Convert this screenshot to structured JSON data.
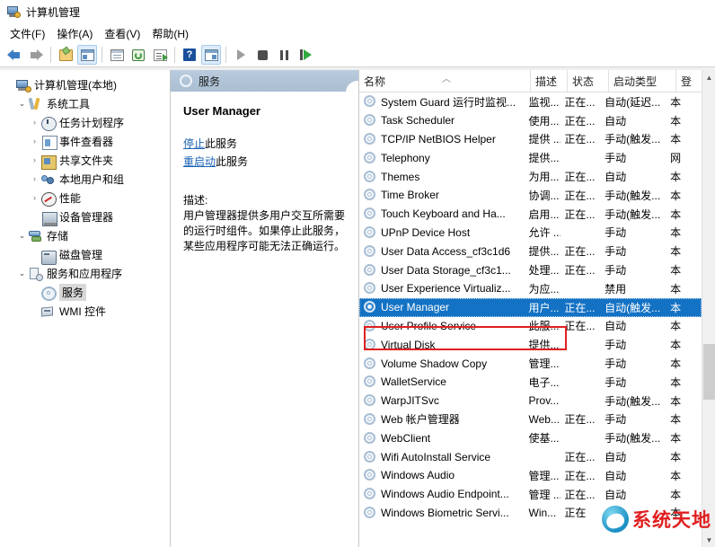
{
  "window": {
    "title": "计算机管理",
    "icon": "computer-management-icon"
  },
  "menu": [
    {
      "label": "文件(F)"
    },
    {
      "label": "操作(A)"
    },
    {
      "label": "查看(V)"
    },
    {
      "label": "帮助(H)"
    }
  ],
  "toolbar": [
    {
      "name": "back-arrow-icon",
      "kind": "back"
    },
    {
      "name": "forward-arrow-icon",
      "kind": "forward"
    },
    {
      "name": "up-folder-icon",
      "kind": "folder"
    },
    {
      "name": "show-console-tree-icon",
      "kind": "pane-left",
      "active": true
    },
    {
      "name": "properties-icon",
      "kind": "props"
    },
    {
      "name": "refresh-icon",
      "kind": "refresh"
    },
    {
      "name": "export-list-icon",
      "kind": "export"
    },
    {
      "name": "help-icon",
      "kind": "help"
    },
    {
      "name": "show-action-pane-icon",
      "kind": "pane-right",
      "active": true
    },
    {
      "name": "start-service-icon",
      "kind": "play"
    },
    {
      "name": "stop-service-icon",
      "kind": "stop"
    },
    {
      "name": "pause-service-icon",
      "kind": "pause"
    },
    {
      "name": "restart-service-icon",
      "kind": "restart"
    }
  ],
  "tree": [
    {
      "label": "计算机管理(本地)",
      "indent": 0,
      "chevron": "",
      "icon": "computer",
      "selected": false
    },
    {
      "label": "系统工具",
      "indent": 1,
      "chevron": "open",
      "icon": "tools",
      "selected": false
    },
    {
      "label": "任务计划程序",
      "indent": 2,
      "chevron": "closed",
      "icon": "clock",
      "selected": false
    },
    {
      "label": "事件查看器",
      "indent": 2,
      "chevron": "closed",
      "icon": "event",
      "selected": false
    },
    {
      "label": "共享文件夹",
      "indent": 2,
      "chevron": "closed",
      "icon": "share",
      "selected": false
    },
    {
      "label": "本地用户和组",
      "indent": 2,
      "chevron": "closed",
      "icon": "users",
      "selected": false
    },
    {
      "label": "性能",
      "indent": 2,
      "chevron": "closed",
      "icon": "perf",
      "selected": false
    },
    {
      "label": "设备管理器",
      "indent": 2,
      "chevron": "",
      "icon": "device",
      "selected": false
    },
    {
      "label": "存储",
      "indent": 1,
      "chevron": "open",
      "icon": "storage",
      "selected": false
    },
    {
      "label": "磁盘管理",
      "indent": 2,
      "chevron": "",
      "icon": "disk",
      "selected": false
    },
    {
      "label": "服务和应用程序",
      "indent": 1,
      "chevron": "open",
      "icon": "svcapp",
      "selected": false
    },
    {
      "label": "服务",
      "indent": 2,
      "chevron": "",
      "icon": "gear",
      "selected": true
    },
    {
      "label": "WMI 控件",
      "indent": 2,
      "chevron": "",
      "icon": "wmi",
      "selected": false
    }
  ],
  "detail": {
    "header": "服务",
    "service_name": "User Manager",
    "links": [
      {
        "link": "停止",
        "rest": "此服务"
      },
      {
        "link": "重启动",
        "rest": "此服务"
      }
    ],
    "description_label": "描述:",
    "description": "用户管理器提供多用户交互所需要的运行时组件。如果停止此服务，某些应用程序可能无法正确运行。"
  },
  "list": {
    "columns": [
      {
        "label": "名称",
        "sort": "asc"
      },
      {
        "label": "描述"
      },
      {
        "label": "状态"
      },
      {
        "label": "启动类型"
      },
      {
        "label": "登"
      }
    ],
    "rows": [
      {
        "name": "System Guard 运行时监视...",
        "desc": "监视...",
        "status": "正在...",
        "startup": "自动(延迟...",
        "logon": "本",
        "selected": false
      },
      {
        "name": "Task Scheduler",
        "desc": "使用...",
        "status": "正在...",
        "startup": "自动",
        "logon": "本",
        "selected": false
      },
      {
        "name": "TCP/IP NetBIOS Helper",
        "desc": "提供 ...",
        "status": "正在...",
        "startup": "手动(触发...",
        "logon": "本",
        "selected": false
      },
      {
        "name": "Telephony",
        "desc": "提供...",
        "status": "",
        "startup": "手动",
        "logon": "网",
        "selected": false
      },
      {
        "name": "Themes",
        "desc": "为用...",
        "status": "正在...",
        "startup": "自动",
        "logon": "本",
        "selected": false
      },
      {
        "name": "Time Broker",
        "desc": "协调...",
        "status": "正在...",
        "startup": "手动(触发...",
        "logon": "本",
        "selected": false
      },
      {
        "name": "Touch Keyboard and Ha...",
        "desc": "启用...",
        "status": "正在...",
        "startup": "手动(触发...",
        "logon": "本",
        "selected": false
      },
      {
        "name": "UPnP Device Host",
        "desc": "允许 ...",
        "status": "",
        "startup": "手动",
        "logon": "本",
        "selected": false
      },
      {
        "name": "User Data Access_cf3c1d6",
        "desc": "提供...",
        "status": "正在...",
        "startup": "手动",
        "logon": "本",
        "selected": false
      },
      {
        "name": "User Data Storage_cf3c1...",
        "desc": "处理...",
        "status": "正在...",
        "startup": "手动",
        "logon": "本",
        "selected": false
      },
      {
        "name": "User Experience Virtualiz...",
        "desc": "为应...",
        "status": "",
        "startup": "禁用",
        "logon": "本",
        "selected": false
      },
      {
        "name": "User Manager",
        "desc": "用户...",
        "status": "正在...",
        "startup": "自动(触发...",
        "logon": "本",
        "selected": true
      },
      {
        "name": "User Profile Service",
        "desc": "此服...",
        "status": "正在...",
        "startup": "自动",
        "logon": "本",
        "selected": false
      },
      {
        "name": "Virtual Disk",
        "desc": "提供...",
        "status": "",
        "startup": "手动",
        "logon": "本",
        "selected": false
      },
      {
        "name": "Volume Shadow Copy",
        "desc": "管理...",
        "status": "",
        "startup": "手动",
        "logon": "本",
        "selected": false
      },
      {
        "name": "WalletService",
        "desc": "电子...",
        "status": "",
        "startup": "手动",
        "logon": "本",
        "selected": false
      },
      {
        "name": "WarpJITSvc",
        "desc": "Prov...",
        "status": "",
        "startup": "手动(触发...",
        "logon": "本",
        "selected": false
      },
      {
        "name": "Web 帐户管理器",
        "desc": "Web...",
        "status": "正在...",
        "startup": "手动",
        "logon": "本",
        "selected": false
      },
      {
        "name": "WebClient",
        "desc": "使基...",
        "status": "",
        "startup": "手动(触发...",
        "logon": "本",
        "selected": false
      },
      {
        "name": "Wifi AutoInstall Service",
        "desc": "",
        "status": "正在...",
        "startup": "自动",
        "logon": "本",
        "selected": false
      },
      {
        "name": "Windows Audio",
        "desc": "管理...",
        "status": "正在...",
        "startup": "自动",
        "logon": "本",
        "selected": false
      },
      {
        "name": "Windows Audio Endpoint...",
        "desc": "管理 ...",
        "status": "正在...",
        "startup": "自动",
        "logon": "本",
        "selected": false
      },
      {
        "name": "Windows Biometric Servi...",
        "desc": "Win...",
        "status": "正在",
        "startup": "",
        "logon": "本",
        "selected": false
      }
    ]
  },
  "watermark": {
    "text": "系统天地"
  },
  "colors": {
    "selection_blue": "#1472c4",
    "annotation_red": "#e02020",
    "link_blue": "#1a62b5",
    "watermark_red": "#e02020"
  }
}
